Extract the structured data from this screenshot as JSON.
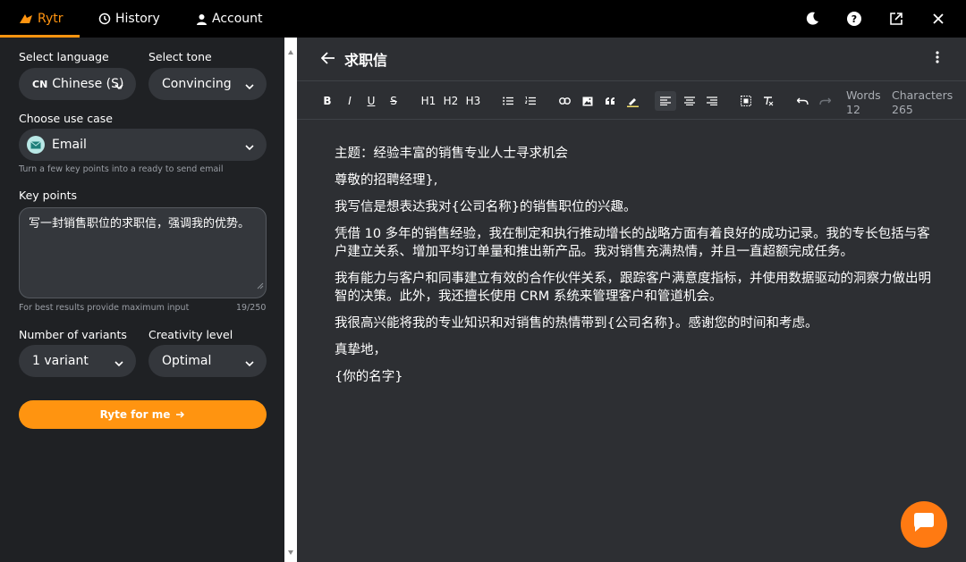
{
  "tabs": {
    "rytr": "Rytr",
    "history": "History",
    "account": "Account"
  },
  "left": {
    "language_label": "Select language",
    "language_value": "Chinese (S)",
    "language_prefix": "CN",
    "tone_label": "Select tone",
    "tone_value": "Convincing",
    "usecase_label": "Choose use case",
    "usecase_value": "Email",
    "usecase_hint": "Turn a few key points into a ready to send email",
    "keypoints_label": "Key points",
    "keypoints_value": "写一封销售职位的求职信，强调我的优势。",
    "keypoints_hint": "For best results provide maximum input",
    "keypoints_count": "19/250",
    "variants_label": "Number of variants",
    "variants_value": "1 variant",
    "creativity_label": "Creativity level",
    "creativity_value": "Optimal",
    "ryte_button": "Ryte for me"
  },
  "editor": {
    "title": "求职信",
    "toolbar": {
      "bold": "B",
      "italic": "I",
      "underline": "U",
      "strike": "S",
      "h1": "H1",
      "h2": "H2",
      "h3": "H3"
    },
    "words_label": "Words",
    "words_value": "12",
    "chars_label": "Characters",
    "chars_value": "265",
    "paragraphs": [
      "主题：经验丰富的销售专业人士寻求机会",
      "尊敬的招聘经理},",
      "我写信是想表达我对{公司名称}的销售职位的兴趣。",
      "凭借 10 多年的销售经验，我在制定和执行推动增长的战略方面有着良好的成功记录。我的专长包括与客户建立关系、增加平均订单量和推出新产品。我对销售充满热情，并且一直超额完成任务。",
      "我有能力与客户和同事建立有效的合作伙伴关系，跟踪客户满意度指标，并使用数据驱动的洞察力做出明智的决策。此外，我还擅长使用 CRM 系统来管理客户和管道机会。",
      "我很高兴能将我的专业知识和对销售的热情带到{公司名称}。感谢您的时间和考虑。",
      "真挚地，",
      "{你的名字}"
    ]
  },
  "colors": {
    "accent": "#ff9410",
    "left_bg": "#1f2124",
    "editor_bg": "#2d2f33",
    "input_bg": "#34373c"
  },
  "icons": [
    "rytr-logo-icon",
    "history-icon",
    "account-icon",
    "moon-icon",
    "help-icon",
    "external-link-icon",
    "close-icon",
    "chevron-down-icon",
    "email-icon",
    "arrow-right-icon",
    "back-arrow-icon",
    "kebab-icon",
    "chat-icon"
  ]
}
